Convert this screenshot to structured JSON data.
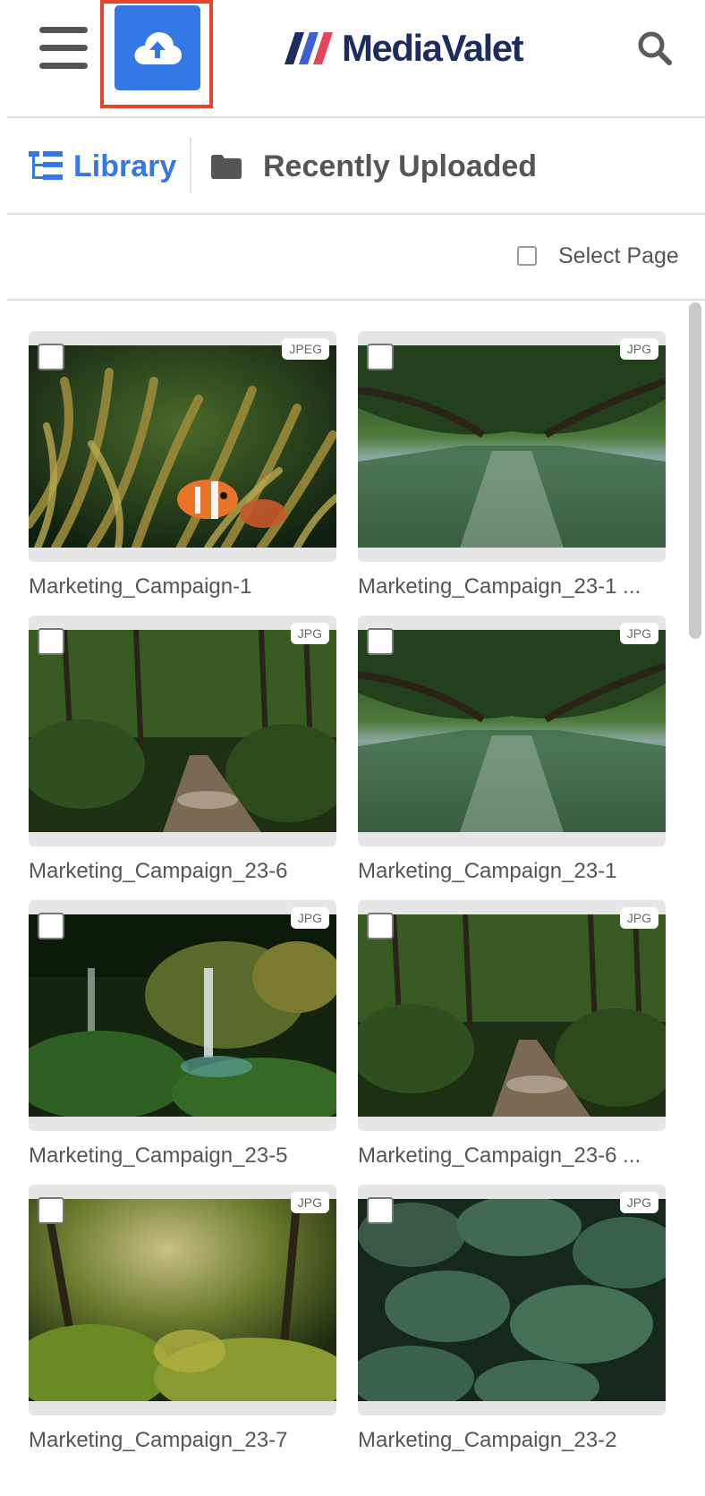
{
  "app": {
    "logo_text": "MediaValet"
  },
  "tabs": [
    {
      "label": "Library",
      "icon": "tree-list-icon",
      "active": true
    },
    {
      "label": "Recently Uploaded",
      "icon": "folder-icon",
      "active": false
    }
  ],
  "select_page": {
    "label": "Select Page"
  },
  "assets": [
    {
      "name": "Marketing_Campaign-1",
      "type": "JPEG",
      "scene": "clownfish-anemone"
    },
    {
      "name": "Marketing_Campaign_23-1 ...",
      "type": "JPG",
      "scene": "river-canopy"
    },
    {
      "name": "Marketing_Campaign_23-6",
      "type": "JPG",
      "scene": "jungle-path"
    },
    {
      "name": "Marketing_Campaign_23-1",
      "type": "JPG",
      "scene": "river-canopy"
    },
    {
      "name": "Marketing_Campaign_23-5",
      "type": "JPG",
      "scene": "jungle-waterfall"
    },
    {
      "name": "Marketing_Campaign_23-6 ...",
      "type": "JPG",
      "scene": "jungle-path"
    },
    {
      "name": "Marketing_Campaign_23-7",
      "type": "JPG",
      "scene": "sunlit-jungle"
    },
    {
      "name": "Marketing_Campaign_23-2",
      "type": "JPG",
      "scene": "monstera-leaves"
    }
  ],
  "colors": {
    "accent": "#3478e6",
    "highlight": "#e8432f",
    "logo": "#1c2c5e"
  }
}
